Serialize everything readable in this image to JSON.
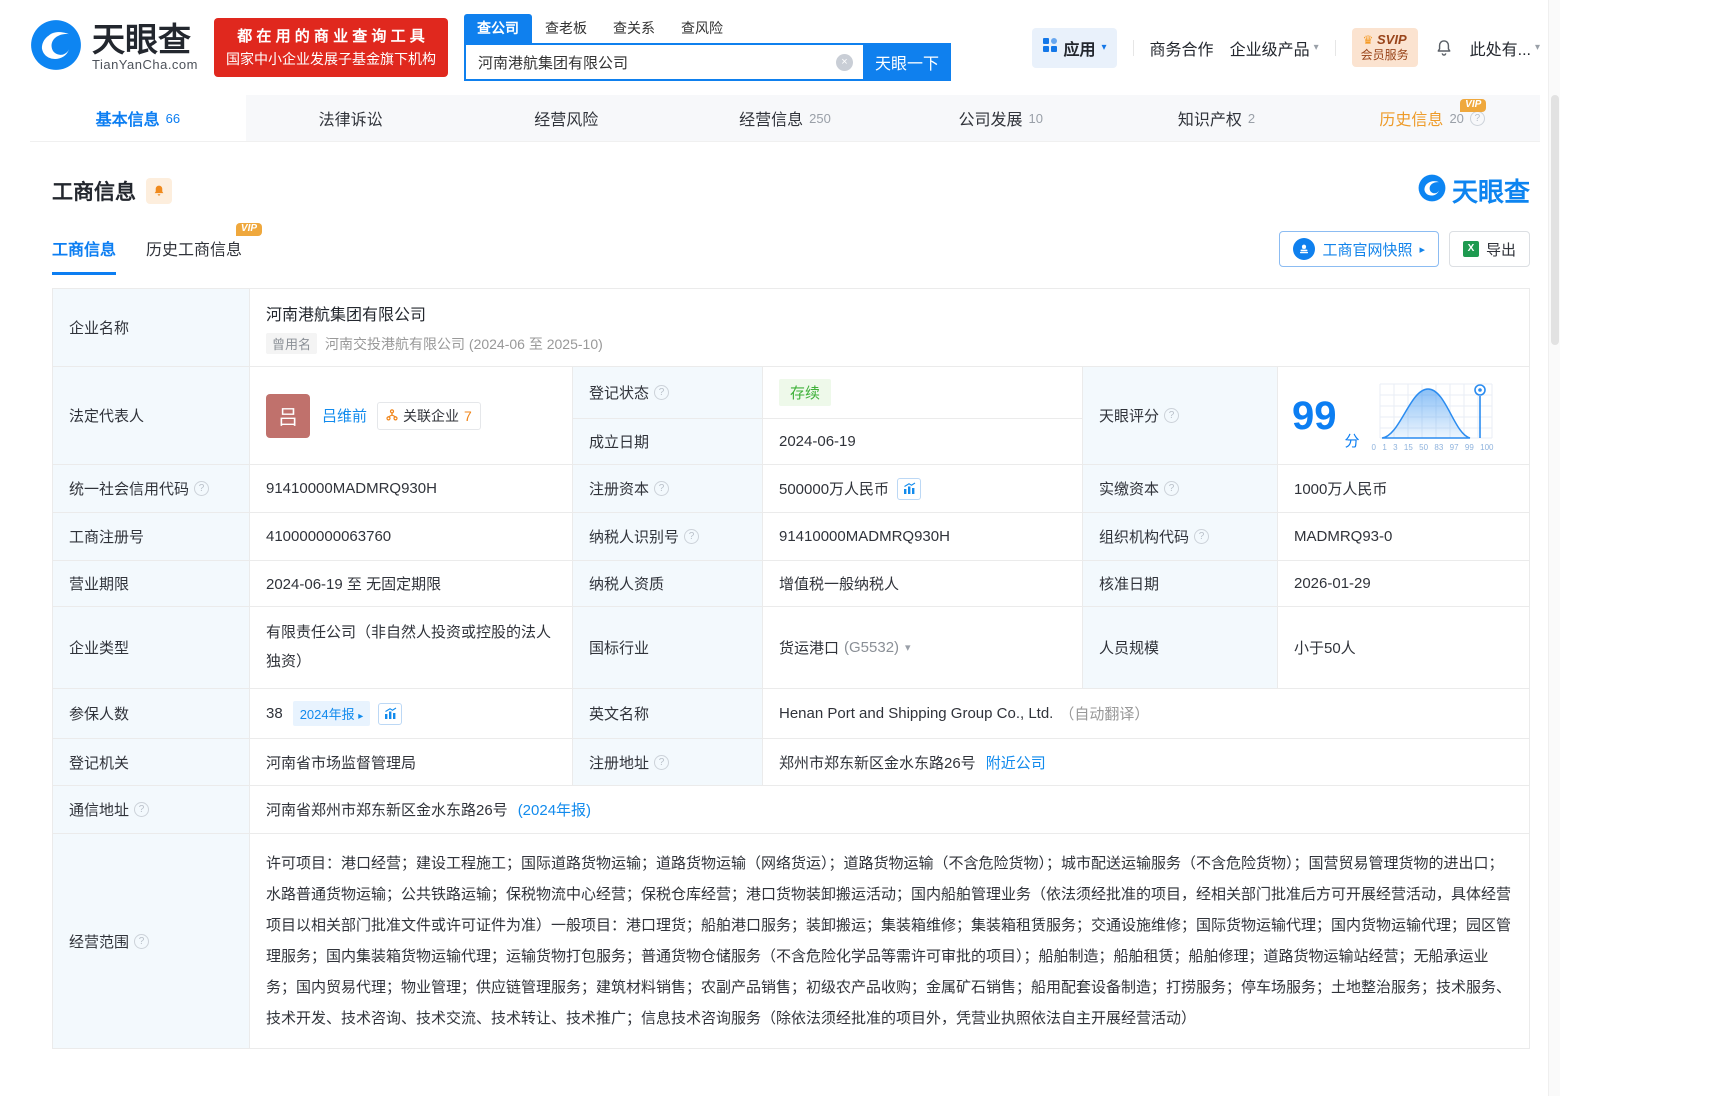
{
  "brand": {
    "name": "天眼查",
    "domain": "TianYanCha.com",
    "promo_line1": "都 在 用 的 商 业 查 询 工 具",
    "promo_line2": "国家中小企业发展子基金旗下机构",
    "watermark": "天眼查"
  },
  "search": {
    "tabs": [
      "查公司",
      "查老板",
      "查关系",
      "查风险"
    ],
    "active_tab": "查公司",
    "value": "河南港航集团有限公司",
    "submit": "天眼一下"
  },
  "topnav": {
    "apps": "应用",
    "cooperation": "商务合作",
    "enterprise_products": "企业级产品",
    "svip_top": "SVIP",
    "svip_bottom": "会员服务",
    "account": "此处有..."
  },
  "page_tabs": [
    {
      "label": "基本信息",
      "count": "66"
    },
    {
      "label": "法律诉讼",
      "count": ""
    },
    {
      "label": "经营风险",
      "count": ""
    },
    {
      "label": "经营信息",
      "count": "250"
    },
    {
      "label": "公司发展",
      "count": "10"
    },
    {
      "label": "知识产权",
      "count": "2"
    },
    {
      "label": "历史信息",
      "count": "20"
    }
  ],
  "section": {
    "title": "工商信息",
    "vip_badge": "VIP",
    "subtab_active": "工商信息",
    "subtab_vip": "历史工商信息",
    "snapshot": "工商官网快照",
    "export": "导出"
  },
  "fields": {
    "name": {
      "label": "企业名称",
      "value": "河南港航集团有限公司",
      "former_tag": "曾用名",
      "former": "河南交投港航有限公司 (2024-06 至 2025-10)"
    },
    "legal_rep": {
      "label": "法定代表人",
      "avatar": "吕",
      "name": "吕维前",
      "related_label": "关联企业",
      "related_count": "7"
    },
    "status": {
      "label": "登记状态",
      "value": "存续"
    },
    "established": {
      "label": "成立日期",
      "value": "2024-06-19"
    },
    "score": {
      "label": "天眼评分",
      "value": "99",
      "unit": "分",
      "ticks": [
        "0",
        "1",
        "3",
        "15",
        "50",
        "83",
        "97",
        "99",
        "100"
      ]
    },
    "credit_code": {
      "label": "统一社会信用代码",
      "value": "91410000MADMRQ930H"
    },
    "reg_capital": {
      "label": "注册资本",
      "value": "500000万人民币"
    },
    "paid_capital": {
      "label": "实缴资本",
      "value": "1000万人民币"
    },
    "reg_no": {
      "label": "工商注册号",
      "value": "410000000063760"
    },
    "tax_id": {
      "label": "纳税人识别号",
      "value": "91410000MADMRQ930H"
    },
    "org_code": {
      "label": "组织机构代码",
      "value": "MADMRQ93-0"
    },
    "term": {
      "label": "营业期限",
      "value": "2024-06-19 至 无固定期限"
    },
    "tax_quality": {
      "label": "纳税人资质",
      "value": "增值税一般纳税人"
    },
    "approval": {
      "label": "核准日期",
      "value": "2026-01-29"
    },
    "type": {
      "label": "企业类型",
      "value": "有限责任公司（非自然人投资或控股的法人独资）"
    },
    "industry": {
      "label": "国标行业",
      "value": "货运港口",
      "code": "(G5532)"
    },
    "staff": {
      "label": "人员规模",
      "value": "小于50人"
    },
    "insured": {
      "label": "参保人数",
      "value": "38",
      "badge": "2024年报"
    },
    "english": {
      "label": "英文名称",
      "value": "Henan Port and Shipping Group Co., Ltd.",
      "note": "（自动翻译）"
    },
    "registry": {
      "label": "登记机关",
      "value": "河南省市场监督管理局"
    },
    "address": {
      "label": "注册地址",
      "value": "郑州市郑东新区金水东路26号",
      "link": "附近公司"
    },
    "mail_address": {
      "label": "通信地址",
      "value": "河南省郑州市郑东新区金水东路26号",
      "link": "(2024年报)"
    },
    "scope": {
      "label": "经营范围",
      "value": "许可项目：港口经营；建设工程施工；国际道路货物运输；道路货物运输（网络货运）；道路货物运输（不含危险货物）；城市配送运输服务（不含危险货物）；国营贸易管理货物的进出口；水路普通货物运输；公共铁路运输；保税物流中心经营；保税仓库经营；港口货物装卸搬运活动；国内船舶管理业务（依法须经批准的项目，经相关部门批准后方可开展经营活动，具体经营项目以相关部门批准文件或许可证件为准）一般项目：港口理货；船舶港口服务；装卸搬运；集装箱维修；集装箱租赁服务；交通设施维修；国际货物运输代理；国内货物运输代理；园区管理服务；国内集装箱货物运输代理；运输货物打包服务；普通货物仓储服务（不含危险化学品等需许可审批的项目）；船舶制造；船舶租赁；船舶修理；道路货物运输站经营；无船承运业务；国内贸易代理；物业管理；供应链管理服务；建筑材料销售；农副产品销售；初级农产品收购；金属矿石销售；船用配套设备制造；打捞服务；停车场服务；土地整治服务；技术服务、技术开发、技术咨询、技术交流、技术转让、技术推广；信息技术咨询服务（除依法须经批准的项目外，凭营业执照依法自主开展经营活动）"
    }
  },
  "colors": {
    "brand_blue": "#0d84f0",
    "link_blue": "#128bed",
    "promo_red": "#e0281e",
    "status_green": "#3fb13a",
    "vip_orange": "#efa83d",
    "score_blue": "#0c7ef2",
    "label_bg": "#f3f9fd"
  },
  "icons": {
    "logo": "blue-circle-swirl",
    "clear": "×",
    "apps_grid": "2x2-squares",
    "caret": "▾",
    "crown": "♛",
    "bell": "bell-outline",
    "help": "?",
    "stamp": "stamp-in-circle",
    "excel": "green-X-square",
    "trend_chart": "bar-chart",
    "org_chart": "node-tree",
    "score_pin": "location-pin",
    "arrow_right": "▸"
  }
}
